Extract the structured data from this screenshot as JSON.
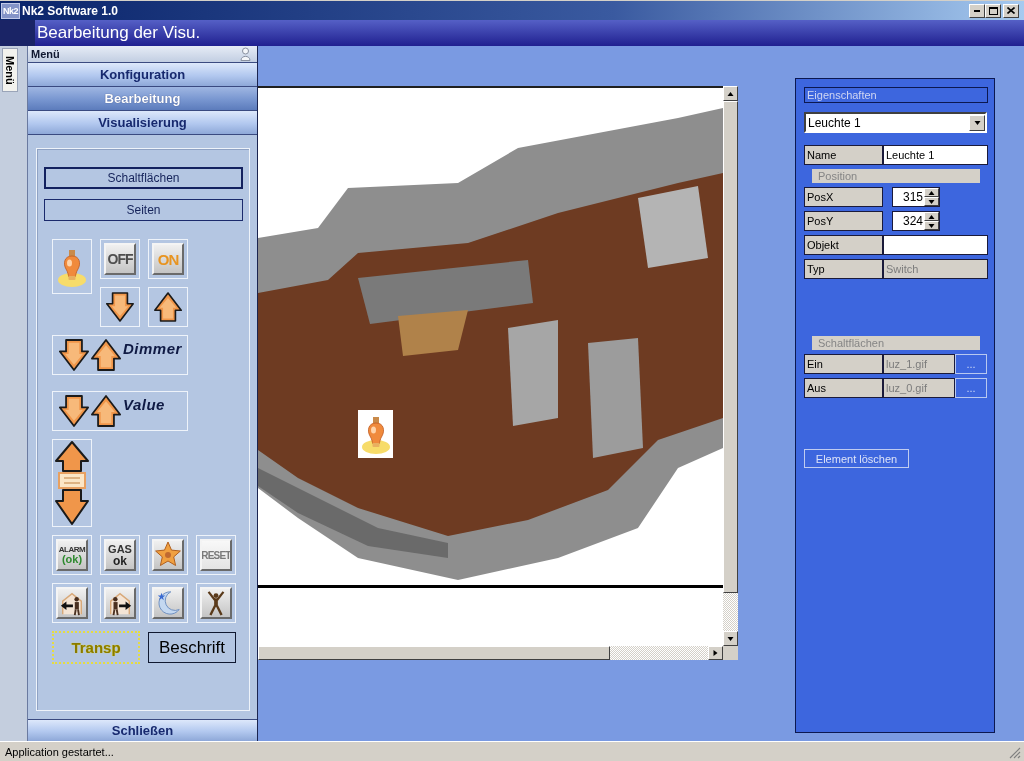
{
  "window": {
    "icon_text": "Nk2",
    "title": "Nk2 Software 1.0"
  },
  "header": {
    "title": "Bearbeitung der Visu."
  },
  "side_tab": {
    "label": "Menü"
  },
  "menu": {
    "title": "Menü",
    "sections": [
      {
        "label": "Konfiguration",
        "selected": false
      },
      {
        "label": "Bearbeitung",
        "selected": true
      },
      {
        "label": "Visualisierung",
        "selected": false
      }
    ],
    "tabs": [
      {
        "label": "Schaltflächen",
        "selected": true
      },
      {
        "label": "Seiten",
        "selected": false
      }
    ],
    "palette": [
      {
        "kind": "lamp"
      },
      {
        "kind": "off",
        "text": "OFF"
      },
      {
        "kind": "on",
        "text": "ON"
      },
      {
        "kind": "down"
      },
      {
        "kind": "up"
      },
      {
        "kind": "dimmer",
        "label": "Dimmer"
      },
      {
        "kind": "dimmer",
        "label": "Value"
      },
      {
        "kind": "slider"
      },
      {
        "kind": "alarm",
        "lines": [
          "ALARM",
          "(ok)"
        ]
      },
      {
        "kind": "gas",
        "lines": [
          "GAS",
          "ok"
        ]
      },
      {
        "kind": "star"
      },
      {
        "kind": "reset",
        "text": "RESET"
      },
      {
        "kind": "leave"
      },
      {
        "kind": "enter"
      },
      {
        "kind": "moon"
      },
      {
        "kind": "person"
      },
      {
        "kind": "transparent",
        "label": "Transp"
      },
      {
        "kind": "caption",
        "label": "Beschrift"
      }
    ],
    "close_button": "Schließen"
  },
  "canvas": {
    "elements": [
      {
        "kind": "lamp"
      }
    ]
  },
  "properties": {
    "title": "Eigenschaften",
    "element_select": {
      "value": "Leuchte 1"
    },
    "fields": [
      {
        "kind": "text",
        "label": "Name",
        "value": "Leuchte 1"
      },
      {
        "kind": "section",
        "label": "Position"
      },
      {
        "kind": "spin",
        "label": "PosX",
        "value": "315"
      },
      {
        "kind": "spin",
        "label": "PosY",
        "value": "324"
      },
      {
        "kind": "text",
        "label": "Objekt"
      },
      {
        "kind": "readonly",
        "label": "Typ",
        "value": "Switch"
      }
    ],
    "buttons_section": {
      "title": "Schaltflächen",
      "rows": [
        {
          "label": "Ein",
          "value": "luz_1.gif",
          "browse": "..."
        },
        {
          "label": "Aus",
          "value": "luz_0.gif",
          "browse": "..."
        }
      ]
    },
    "delete_button": "Element löschen"
  },
  "status_bar": {
    "text": "Application gestartet..."
  }
}
